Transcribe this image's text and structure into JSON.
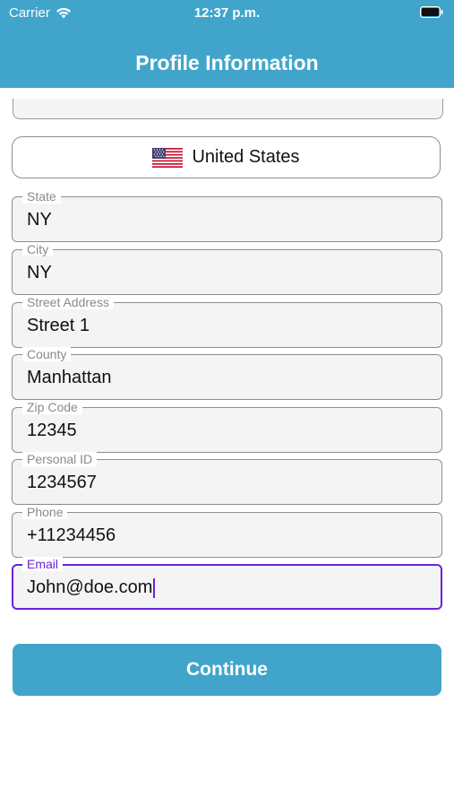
{
  "status_bar": {
    "carrier": "Carrier",
    "time": "12:37 p.m.",
    "wifi_icon": "wifi-icon",
    "battery_icon": "battery-icon"
  },
  "header": {
    "title": "Profile Information",
    "background": "#41a5cb"
  },
  "country": {
    "name": "United States",
    "flag_icon": "us-flag-icon"
  },
  "fields": {
    "state": {
      "label": "State",
      "value": "NY"
    },
    "city": {
      "label": "City",
      "value": "NY"
    },
    "street": {
      "label": "Street Address",
      "value": "Street 1"
    },
    "county": {
      "label": "County",
      "value": "Manhattan"
    },
    "zip": {
      "label": "Zip Code",
      "value": "12345"
    },
    "personal_id": {
      "label": "Personal ID",
      "value": "1234567"
    },
    "phone": {
      "label": "Phone",
      "value": "+11234456"
    },
    "email": {
      "label": "Email",
      "value": "John@doe.com",
      "focused": true
    }
  },
  "actions": {
    "continue_label": "Continue"
  },
  "colors": {
    "accent": "#41a5cb",
    "focus": "#6c22d8"
  }
}
